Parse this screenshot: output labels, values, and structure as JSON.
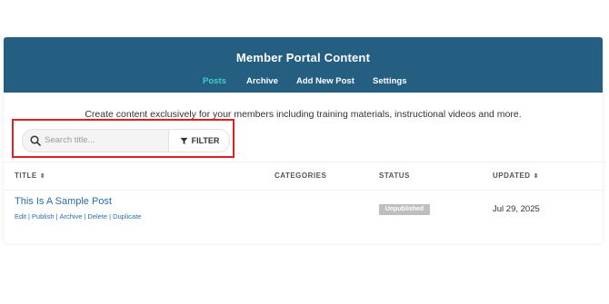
{
  "header": {
    "title": "Member Portal Content",
    "tabs": [
      {
        "label": "Posts",
        "active": true
      },
      {
        "label": "Archive",
        "active": false
      },
      {
        "label": "Add New Post",
        "active": false
      },
      {
        "label": "Settings",
        "active": false
      }
    ]
  },
  "intro": "Create content exclusively for your members including training materials, instructional videos and more.",
  "search": {
    "placeholder": "Search title...",
    "value": "",
    "icon": "search-icon"
  },
  "filter": {
    "label": "FILTER",
    "icon": "funnel-icon"
  },
  "table": {
    "columns": [
      {
        "label": "TITLE",
        "sortable": true
      },
      {
        "label": "CATEGORIES",
        "sortable": false
      },
      {
        "label": "STATUS",
        "sortable": false
      },
      {
        "label": "UPDATED",
        "sortable": true
      }
    ],
    "rows": [
      {
        "title": "This Is A Sample Post",
        "actions": [
          "Edit",
          "Publish",
          "Archive",
          "Delete",
          "Duplicate"
        ],
        "categories": "",
        "status": "Unpublished",
        "updated": "Jul 29, 2025"
      }
    ]
  },
  "colors": {
    "header_bg": "#245f82",
    "active_tab": "#3fd0c1",
    "link": "#2a6bb0",
    "highlight": "#e02020",
    "badge": "#bfbfbf"
  }
}
